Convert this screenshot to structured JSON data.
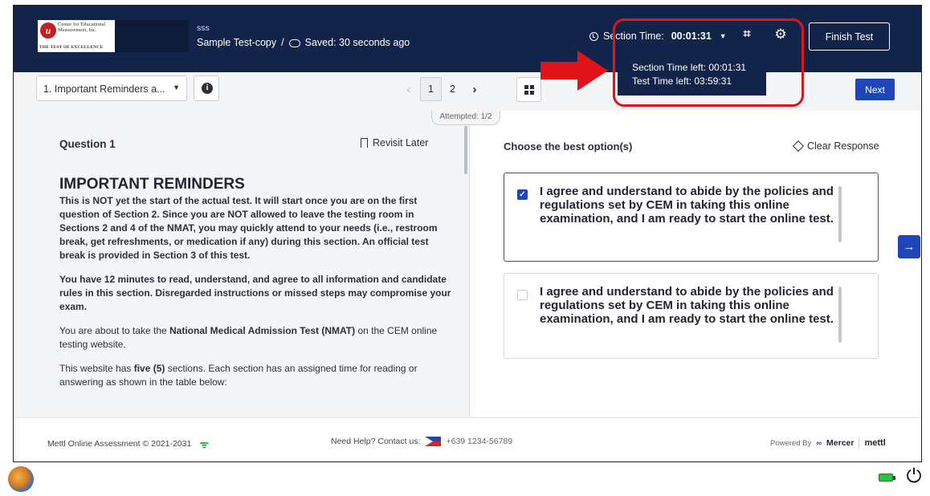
{
  "header": {
    "logo_text": "Center for Educational Measurement, Inc.",
    "logo_tagline": "THE TEST OF EXCELLENCE",
    "test_code": "sss",
    "test_name": "Sample Test-copy",
    "breadcrumb_sep": "/",
    "saved_status": "Saved: 30 seconds ago",
    "section_time_label": "Section Time:",
    "section_time_value": "00:01:31",
    "finish_label": "Finish Test"
  },
  "tooltip": {
    "section_time_left": "Section Time left: 00:01:31",
    "test_time_left": "Test Time left: 03:59:31"
  },
  "toolbar": {
    "section_select": "1. Important Reminders a...",
    "pages": [
      "1",
      "2"
    ],
    "current_page": "1",
    "attempted": "Attempted: 1/2",
    "next_label": "Next"
  },
  "question": {
    "label": "Question 1",
    "revisit_label": "Revisit Later",
    "heading": "IMPORTANT REMINDERS",
    "para1": "This is NOT yet the start of the actual test. It will start once you are on the first question of Section 2. Since you are NOT allowed to leave the testing room in Sections 2 and 4 of the NMAT, you may quickly attend to your needs (i.e., restroom break, get refreshments, or medication if any) during this section. An official test break is provided in Section 3 of this test.",
    "para2": "You have 12 minutes to read, understand, and agree to all information and candidate rules in this section. Disregarded instructions or missed steps may compromise your exam.",
    "para3_pre": "You are about to take the ",
    "para3_bold": "National Medical Admission Test (NMAT)",
    "para3_post": " on the CEM online testing website.",
    "para4_pre": "This website has ",
    "para4_bold": "five (5)",
    "para4_post": " sections. Each section has an assigned time for reading or answering as shown in the table below:"
  },
  "answer": {
    "prompt": "Choose the best option(s)",
    "clear_label": "Clear Response",
    "options": [
      {
        "text": "I agree and understand to abide by the policies and regulations set by CEM in taking this online examination, and I am ready to start the online test.",
        "checked": true
      },
      {
        "text": "I agree and understand to abide by the policies and regulations set by CEM in taking this online examination, and I am ready to start the online test.",
        "checked": false
      }
    ]
  },
  "footer": {
    "copyright": "Mettl Online Assessment © 2021-2031",
    "help_label": "Need Help? Contact us:",
    "phone": "+639 1234-56789",
    "powered_by": "Powered By",
    "mercer": "Mercer",
    "mettl": "mettl"
  },
  "colors": {
    "header_bg": "#13244a",
    "accent": "#1f46b8",
    "annotation": "#e0131b"
  }
}
